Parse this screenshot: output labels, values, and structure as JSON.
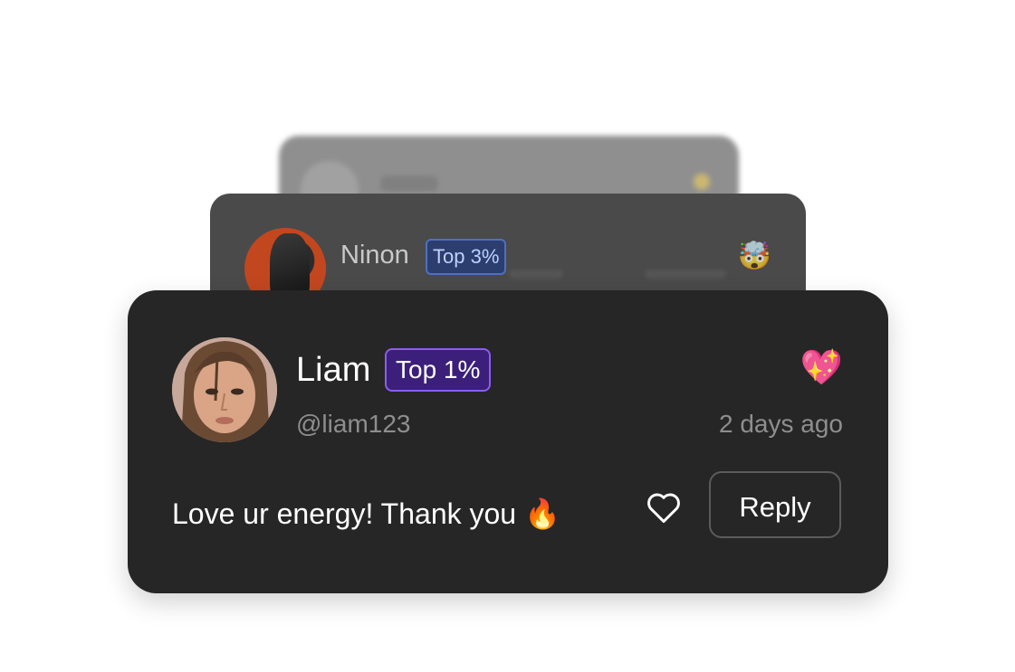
{
  "back_card": {},
  "middle_card": {
    "name": "Ninon",
    "badge": "Top 3%",
    "reaction_emoji": "🤯"
  },
  "front_card": {
    "name": "Liam",
    "badge": "Top 1%",
    "handle": "@liam123",
    "reaction_emoji": "💖",
    "timestamp": "2 days ago",
    "message": "Love ur energy! Thank you 🔥",
    "reply_label": "Reply",
    "like_icon": "heart-outline"
  },
  "colors": {
    "card_bg": "#262626",
    "badge_bg": "#3b1f7a",
    "badge_border": "#8c5cf0",
    "muted_text": "#8e8e8e",
    "mid_badge_bg": "#2b3e6e",
    "mid_badge_border": "#4f6fc4"
  }
}
